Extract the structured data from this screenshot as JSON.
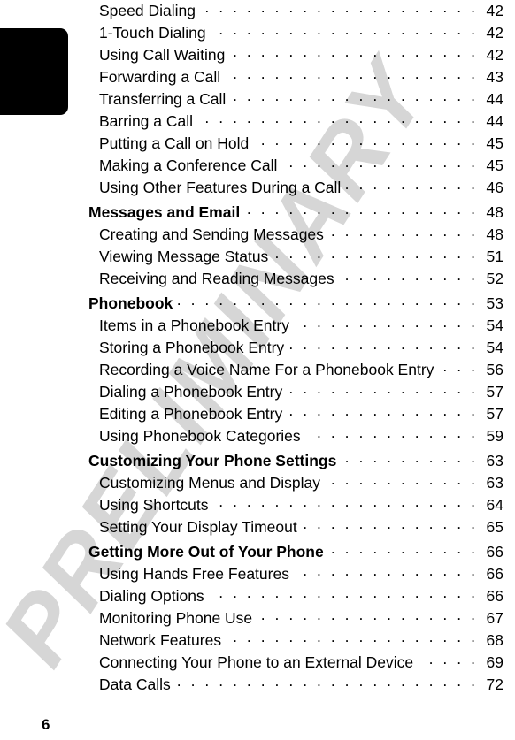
{
  "document": {
    "page_number": "6",
    "watermark_text": "PRELIMINARY",
    "watermark_color": "#d6d6d6",
    "text_color": "#000000",
    "tab_color": "#000000",
    "background_color": "#ffffff"
  },
  "toc": {
    "entries": [
      {
        "level": 2,
        "label": "Speed Dialing",
        "page": "42"
      },
      {
        "level": 2,
        "label": "1-Touch Dialing",
        "page": "42"
      },
      {
        "level": 2,
        "label": "Using Call Waiting",
        "page": "42"
      },
      {
        "level": 2,
        "label": "Forwarding a Call",
        "page": "43"
      },
      {
        "level": 2,
        "label": "Transferring a Call",
        "page": "44"
      },
      {
        "level": 2,
        "label": "Barring a Call",
        "page": "44"
      },
      {
        "level": 2,
        "label": "Putting a Call on Hold",
        "page": "45"
      },
      {
        "level": 2,
        "label": "Making a Conference Call",
        "page": "45"
      },
      {
        "level": 2,
        "label": "Using Other Features During a Call",
        "page": "46"
      },
      {
        "level": 1,
        "label": "Messages and Email",
        "page": "48"
      },
      {
        "level": 2,
        "label": "Creating and Sending Messages",
        "page": "48"
      },
      {
        "level": 2,
        "label": "Viewing Message Status",
        "page": "51"
      },
      {
        "level": 2,
        "label": "Receiving and Reading Messages",
        "page": "52"
      },
      {
        "level": 1,
        "label": "Phonebook",
        "page": "53"
      },
      {
        "level": 2,
        "label": "Items in a Phonebook Entry",
        "page": "54"
      },
      {
        "level": 2,
        "label": "Storing a Phonebook Entry",
        "page": "54"
      },
      {
        "level": 2,
        "label": "Recording a Voice Name For a Phonebook Entry",
        "page": "56"
      },
      {
        "level": 2,
        "label": "Dialing a Phonebook Entry",
        "page": "57"
      },
      {
        "level": 2,
        "label": "Editing a Phonebook Entry",
        "page": "57"
      },
      {
        "level": 2,
        "label": "Using Phonebook Categories",
        "page": "59"
      },
      {
        "level": 1,
        "label": "Customizing Your Phone Settings",
        "page": "63"
      },
      {
        "level": 2,
        "label": "Customizing Menus and Display",
        "page": "63"
      },
      {
        "level": 2,
        "label": "Using Shortcuts",
        "page": "64"
      },
      {
        "level": 2,
        "label": "Setting Your Display Timeout",
        "page": "65"
      },
      {
        "level": 1,
        "label": "Getting More Out of Your Phone",
        "page": "66"
      },
      {
        "level": 2,
        "label": "Using Hands Free Features",
        "page": "66"
      },
      {
        "level": 2,
        "label": "Dialing Options",
        "page": "66"
      },
      {
        "level": 2,
        "label": "Monitoring Phone Use",
        "page": "67"
      },
      {
        "level": 2,
        "label": "Network Features",
        "page": "68"
      },
      {
        "level": 2,
        "label": "Connecting Your Phone to an External Device",
        "page": "69"
      },
      {
        "level": 2,
        "label": "Data Calls",
        "page": "72"
      }
    ]
  }
}
